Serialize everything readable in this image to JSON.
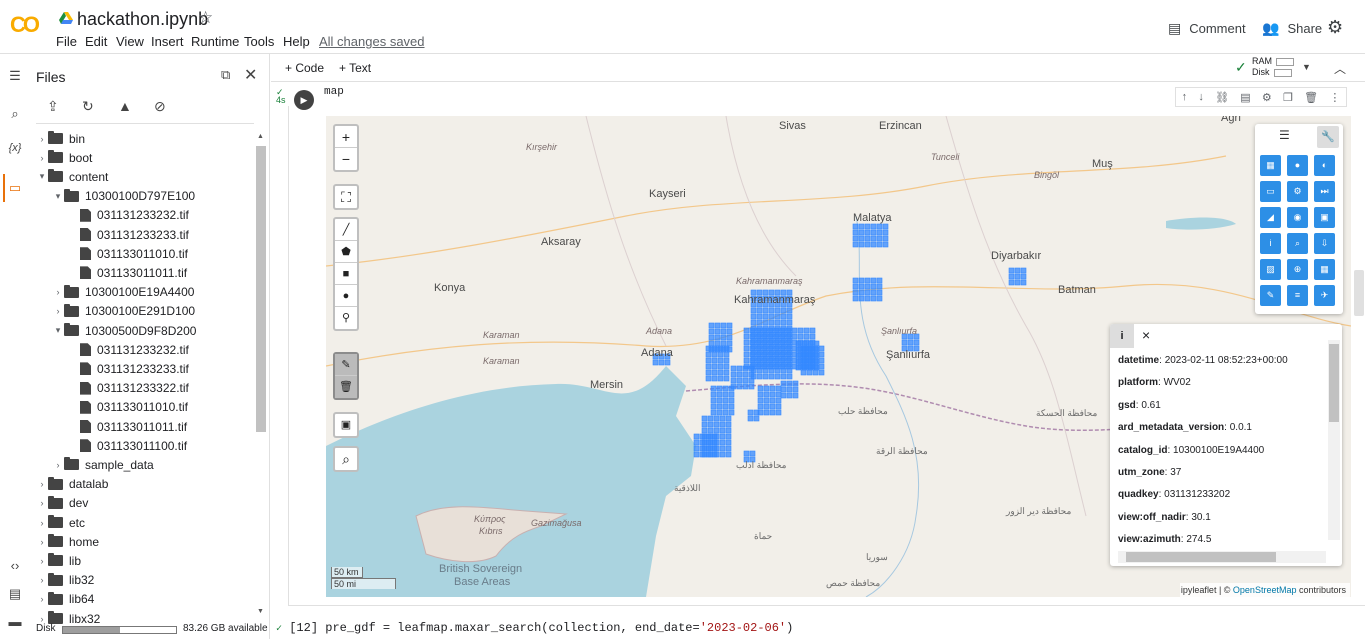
{
  "app": {
    "logo": "CO",
    "notebook_title": "hackathon.ipynb",
    "save_status": "All changes saved"
  },
  "menu": [
    "File",
    "Edit",
    "View",
    "Insert",
    "Runtime",
    "Tools",
    "Help"
  ],
  "header_actions": {
    "comment": "Comment",
    "share": "Share"
  },
  "files_panel": {
    "title": "Files",
    "tree": [
      {
        "kind": "folder",
        "name": "bin",
        "depth": 0,
        "open": false
      },
      {
        "kind": "folder",
        "name": "boot",
        "depth": 0,
        "open": false
      },
      {
        "kind": "folder",
        "name": "content",
        "depth": 0,
        "open": true
      },
      {
        "kind": "folder",
        "name": "10300100D797E100",
        "depth": 1,
        "open": true
      },
      {
        "kind": "file",
        "name": "031131233232.tif",
        "depth": 2
      },
      {
        "kind": "file",
        "name": "031131233233.tif",
        "depth": 2
      },
      {
        "kind": "file",
        "name": "031133011010.tif",
        "depth": 2
      },
      {
        "kind": "file",
        "name": "031133011011.tif",
        "depth": 2
      },
      {
        "kind": "folder",
        "name": "10300100E19A4400",
        "depth": 1,
        "open": false
      },
      {
        "kind": "folder",
        "name": "10300100E291D100",
        "depth": 1,
        "open": false
      },
      {
        "kind": "folder",
        "name": "10300500D9F8D200",
        "depth": 1,
        "open": true
      },
      {
        "kind": "file",
        "name": "031131233232.tif",
        "depth": 2
      },
      {
        "kind": "file",
        "name": "031131233233.tif",
        "depth": 2
      },
      {
        "kind": "file",
        "name": "031131233322.tif",
        "depth": 2
      },
      {
        "kind": "file",
        "name": "031133011010.tif",
        "depth": 2
      },
      {
        "kind": "file",
        "name": "031133011011.tif",
        "depth": 2
      },
      {
        "kind": "file",
        "name": "031133011100.tif",
        "depth": 2
      },
      {
        "kind": "folder",
        "name": "sample_data",
        "depth": 1,
        "open": false
      },
      {
        "kind": "folder",
        "name": "datalab",
        "depth": 0,
        "open": false
      },
      {
        "kind": "folder",
        "name": "dev",
        "depth": 0,
        "open": false
      },
      {
        "kind": "folder",
        "name": "etc",
        "depth": 0,
        "open": false
      },
      {
        "kind": "folder",
        "name": "home",
        "depth": 0,
        "open": false
      },
      {
        "kind": "folder",
        "name": "lib",
        "depth": 0,
        "open": false
      },
      {
        "kind": "folder",
        "name": "lib32",
        "depth": 0,
        "open": false
      },
      {
        "kind": "folder",
        "name": "lib64",
        "depth": 0,
        "open": false
      },
      {
        "kind": "folder",
        "name": "libx32",
        "depth": 0,
        "open": false
      }
    ],
    "disk_label": "Disk",
    "disk_available": "83.26 GB available",
    "disk_used_fraction": 0.5
  },
  "rail": {
    "code_symbol": "{x}"
  },
  "toolbar": {
    "code": "+ Code",
    "text": "+ Text",
    "ram_label": "RAM",
    "disk_label": "Disk"
  },
  "cell": {
    "exec_time": "4s",
    "code": "map"
  },
  "map": {
    "labels": {
      "sivas": "Sivas",
      "erzincan": "Erzincan",
      "agri": "Ağrı",
      "kirsehir": "Kırşehir",
      "kayseri": "Kayseri",
      "aksaray": "Aksaray",
      "konya": "Konya",
      "karaman": "Karaman",
      "mersin": "Mersin",
      "adana": "Adana",
      "kahramanmaras": "Kahramanmaraş",
      "malatya": "Malatya",
      "diyarbakir": "Diyarbakır",
      "batman": "Batman",
      "mus": "Muş",
      "sanliurfa": "Şanlıurfa",
      "bingol": "Bingöl",
      "tunceli": "Tunceli",
      "kipros": "Κύπρος",
      "kibris": "Kıbrıs",
      "gazimagusa": "Gazimağusa",
      "british": "British Sovereign",
      "base": "Base Areas",
      "sorya": "سوريا",
      "lattakia": "اللاذقية",
      "hama": "حماة",
      "hasakah": "محافظة الحسكة",
      "raqqa": "محافظة الرقة",
      "idlib": "محافظة ادلب",
      "aleppo": "محافظة حلب",
      "deir": "محافظة دير الزور",
      "homs": "محافظة حمص"
    },
    "scale": {
      "km": "50 km",
      "mi": "50 mi"
    },
    "attribution_prefix": "ipyleaflet | © ",
    "attribution_link": "OpenStreetMap",
    "attribution_suffix": " contributors",
    "footprint_color": "#3388ff"
  },
  "info_panel": {
    "icon": "i",
    "close": "×",
    "rows": [
      {
        "key": "datetime",
        "value": "2023-02-11 08:52:23+00:00"
      },
      {
        "key": "platform",
        "value": "WV02"
      },
      {
        "key": "gsd",
        "value": "0.61"
      },
      {
        "key": "ard_metadata_version",
        "value": "0.0.1"
      },
      {
        "key": "catalog_id",
        "value": "10300100E19A4400"
      },
      {
        "key": "utm_zone",
        "value": "37"
      },
      {
        "key": "quadkey",
        "value": "031131233202"
      },
      {
        "key": "view:off_nadir",
        "value": "30.1"
      },
      {
        "key": "view:azimuth",
        "value": "274.5"
      }
    ]
  },
  "next_cell": {
    "exec_label": "[12]",
    "code_prefix": "pre_gdf = leafmap.maxar_search(collection, end_date=",
    "code_string": "'2023-02-06'",
    "code_suffix": ")"
  }
}
